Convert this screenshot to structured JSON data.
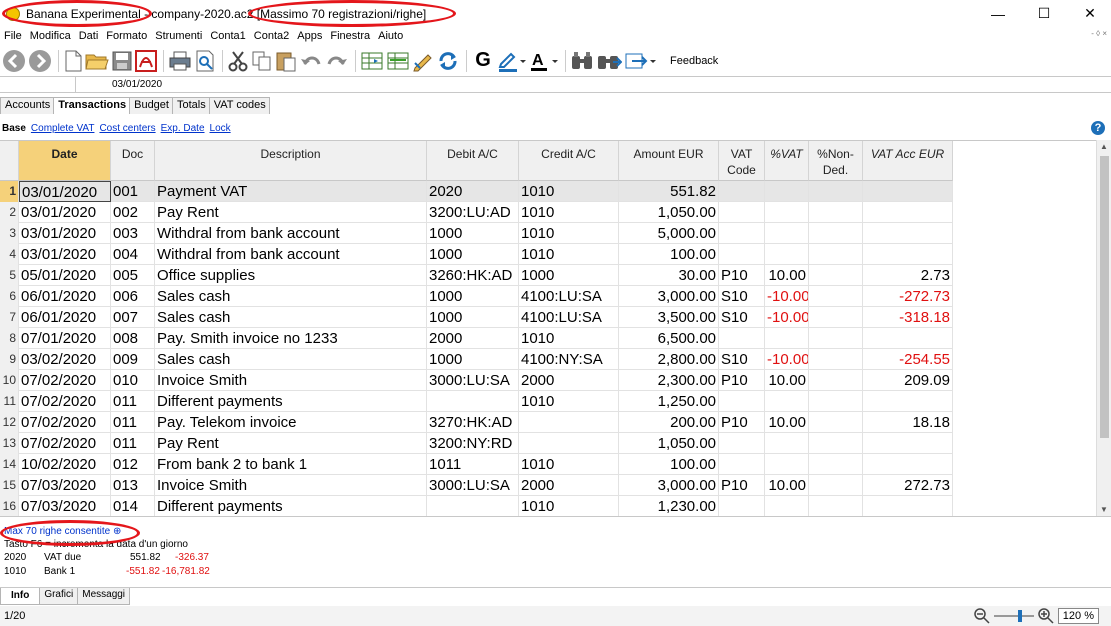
{
  "window": {
    "title": "Banana Experimental - company-2020.ac2 [Massimo 70 registrazioni/righe]",
    "controls": [
      "—",
      "☐",
      "✕"
    ]
  },
  "menu": [
    "File",
    "Modifica",
    "Dati",
    "Formato",
    "Strumenti",
    "Conta1",
    "Conta2",
    "Apps",
    "Finestra",
    "Aiuto"
  ],
  "menu_right": "- ◊ ×",
  "toolbar": {
    "feedback_label": "Feedback",
    "icons": [
      "back-icon",
      "forward-icon",
      "new-file-icon",
      "open-folder-icon",
      "save-icon",
      "pdf-icon",
      "print-icon",
      "print-preview-icon",
      "cut-icon",
      "copy-icon",
      "paste-icon",
      "undo-icon",
      "redo-icon",
      "add-row-icon",
      "insert-row-icon",
      "edit-icon",
      "recalculate-icon",
      "bold-icon",
      "highlight-icon",
      "font-color-icon",
      "find-icon",
      "find-next-icon",
      "send-icon"
    ],
    "bold_glyph": "G",
    "font_color_glyph": "A"
  },
  "cellbar": {
    "value": "03/01/2020"
  },
  "tabs": [
    "Accounts",
    "Transactions",
    "Budget",
    "Totals",
    "VAT codes"
  ],
  "active_tab": "Transactions",
  "views": [
    "Base",
    "Complete VAT",
    "Cost centers",
    "Exp. Date",
    "Lock"
  ],
  "columns": {
    "date": "Date",
    "doc": "Doc",
    "description": "Description",
    "debit": "Debit A/C",
    "credit": "Credit A/C",
    "amount": "Amount EUR",
    "vatcode_1": "VAT",
    "vatcode_2": "Code",
    "vatpct": "%VAT",
    "nonded_1": "%Non-",
    "nonded_2": "Ded.",
    "vatacc": "VAT Acc EUR"
  },
  "rows": [
    {
      "n": "1",
      "date": "03/01/2020",
      "doc": "001",
      "desc": "Payment VAT",
      "debit": "2020",
      "credit": "1010",
      "amount": "551.82",
      "vatcode": "",
      "vatpct": "",
      "nonded": "",
      "vatacc": ""
    },
    {
      "n": "2",
      "date": "03/01/2020",
      "doc": "002",
      "desc": "Pay Rent",
      "debit": "3200:LU:AD",
      "credit": "1010",
      "amount": "1,050.00",
      "vatcode": "",
      "vatpct": "",
      "nonded": "",
      "vatacc": ""
    },
    {
      "n": "3",
      "date": "03/01/2020",
      "doc": "003",
      "desc": "Withdral from bank account",
      "debit": "1000",
      "credit": "1010",
      "amount": "5,000.00",
      "vatcode": "",
      "vatpct": "",
      "nonded": "",
      "vatacc": ""
    },
    {
      "n": "4",
      "date": "03/01/2020",
      "doc": "004",
      "desc": "Withdral from bank account",
      "debit": "1000",
      "credit": "1010",
      "amount": "100.00",
      "vatcode": "",
      "vatpct": "",
      "nonded": "",
      "vatacc": ""
    },
    {
      "n": "5",
      "date": "05/01/2020",
      "doc": "005",
      "desc": "Office supplies",
      "debit": "3260:HK:AD",
      "credit": "1000",
      "amount": "30.00",
      "vatcode": "P10",
      "vatpct": "10.00",
      "nonded": "",
      "vatacc": "2.73"
    },
    {
      "n": "6",
      "date": "06/01/2020",
      "doc": "006",
      "desc": "Sales cash",
      "debit": "1000",
      "credit": "4100:LU:SA",
      "amount": "3,000.00",
      "vatcode": "S10",
      "vatpct": "-10.00",
      "nonded": "",
      "vatacc": "-272.73"
    },
    {
      "n": "7",
      "date": "06/01/2020",
      "doc": "007",
      "desc": "Sales cash",
      "debit": "1000",
      "credit": "4100:LU:SA",
      "amount": "3,500.00",
      "vatcode": "S10",
      "vatpct": "-10.00",
      "nonded": "",
      "vatacc": "-318.18"
    },
    {
      "n": "8",
      "date": "07/01/2020",
      "doc": "008",
      "desc": "Pay. Smith invoice no 1233",
      "debit": "2000",
      "credit": "1010",
      "amount": "6,500.00",
      "vatcode": "",
      "vatpct": "",
      "nonded": "",
      "vatacc": ""
    },
    {
      "n": "9",
      "date": "03/02/2020",
      "doc": "009",
      "desc": "Sales cash",
      "debit": "1000",
      "credit": "4100:NY:SA",
      "amount": "2,800.00",
      "vatcode": "S10",
      "vatpct": "-10.00",
      "nonded": "",
      "vatacc": "-254.55"
    },
    {
      "n": "10",
      "date": "07/02/2020",
      "doc": "010",
      "desc": "Invoice Smith",
      "debit": "3000:LU:SA",
      "credit": "2000",
      "amount": "2,300.00",
      "vatcode": "P10",
      "vatpct": "10.00",
      "nonded": "",
      "vatacc": "209.09"
    },
    {
      "n": "11",
      "date": "07/02/2020",
      "doc": "011",
      "desc": "Different payments",
      "debit": "",
      "credit": "1010",
      "amount": "1,250.00",
      "vatcode": "",
      "vatpct": "",
      "nonded": "",
      "vatacc": ""
    },
    {
      "n": "12",
      "date": "07/02/2020",
      "doc": "011",
      "desc": "Pay. Telekom invoice",
      "debit": "3270:HK:AD",
      "credit": "",
      "amount": "200.00",
      "vatcode": "P10",
      "vatpct": "10.00",
      "nonded": "",
      "vatacc": "18.18"
    },
    {
      "n": "13",
      "date": "07/02/2020",
      "doc": "011",
      "desc": "Pay Rent",
      "debit": "3200:NY:RD",
      "credit": "",
      "amount": "1,050.00",
      "vatcode": "",
      "vatpct": "",
      "nonded": "",
      "vatacc": ""
    },
    {
      "n": "14",
      "date": "10/02/2020",
      "doc": "012",
      "desc": "From bank 2 to bank 1",
      "debit": "1011",
      "credit": "1010",
      "amount": "100.00",
      "vatcode": "",
      "vatpct": "",
      "nonded": "",
      "vatacc": ""
    },
    {
      "n": "15",
      "date": "07/03/2020",
      "doc": "013",
      "desc": "Invoice Smith",
      "debit": "3000:LU:SA",
      "credit": "2000",
      "amount": "3,000.00",
      "vatcode": "P10",
      "vatpct": "10.00",
      "nonded": "",
      "vatacc": "272.73"
    },
    {
      "n": "16",
      "date": "07/03/2020",
      "doc": "014",
      "desc": "Different payments",
      "debit": "",
      "credit": "1010",
      "amount": "1,230.00",
      "vatcode": "",
      "vatpct": "",
      "nonded": "",
      "vatacc": ""
    }
  ],
  "info": {
    "link": "Max 70 righe consentite ⊕",
    "hint": "Tasto F6 = incrementa la data d'un giorno",
    "lines": [
      {
        "acc": "2020",
        "name": "VAT due",
        "amt": "551.82",
        "bal": "-326.37"
      },
      {
        "acc": "1010",
        "name": "Bank 1",
        "amt": "-551.82",
        "bal": "-16,781.82"
      }
    ]
  },
  "bottom_tabs": [
    "Info",
    "Grafici",
    "Messaggi"
  ],
  "status": {
    "position": "1/20",
    "zoom": "120 %"
  },
  "colors": {
    "annotation": "#e4161b",
    "header_highlight": "#f5d17a",
    "negative": "#e01010",
    "link": "#0033cc"
  }
}
